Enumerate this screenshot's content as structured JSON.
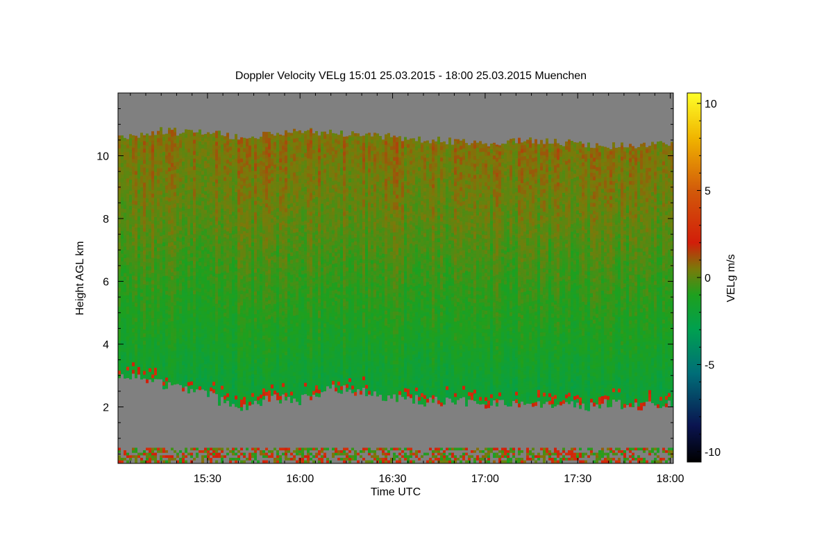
{
  "chart_data": {
    "type": "heatmap",
    "title": "Doppler Velocity VELg   15:01 25.03.2015 - 18:00 25.03.2015 Muenchen",
    "xlabel": "Time UTC",
    "ylabel": "Height AGL km",
    "colorbar_label": "VELg m/s",
    "x_range_minutes_utc": [
      901,
      1081
    ],
    "y_range_km": [
      0.2,
      12.0
    ],
    "x_ticks": [
      {
        "label": "15:30",
        "minute": 930
      },
      {
        "label": "16:00",
        "minute": 960
      },
      {
        "label": "16:30",
        "minute": 990
      },
      {
        "label": "17:00",
        "minute": 1020
      },
      {
        "label": "17:30",
        "minute": 1050
      },
      {
        "label": "18:00",
        "minute": 1080
      }
    ],
    "y_ticks": [
      2,
      4,
      6,
      8,
      10
    ],
    "colorbar_range": [
      -10.6,
      10.6
    ],
    "colorbar_ticks": [
      10,
      5,
      0,
      -5,
      -10
    ],
    "colorbar_stops": [
      {
        "v": -10.6,
        "color": "#000000"
      },
      {
        "v": -8.5,
        "color": "#0a1450"
      },
      {
        "v": -5.5,
        "color": "#006e78"
      },
      {
        "v": -3.0,
        "color": "#00a050"
      },
      {
        "v": -1.0,
        "color": "#1ea01e"
      },
      {
        "v": 0.5,
        "color": "#7a7a0a"
      },
      {
        "v": 2.0,
        "color": "#d21e0a"
      },
      {
        "v": 5.0,
        "color": "#d25a0a"
      },
      {
        "v": 8.0,
        "color": "#f0b400"
      },
      {
        "v": 10.6,
        "color": "#ffff28"
      }
    ],
    "no_data_color": "#808080",
    "cloud_top_km": [
      {
        "t": 901,
        "h": 10.6
      },
      {
        "t": 915,
        "h": 10.8
      },
      {
        "t": 930,
        "h": 10.7
      },
      {
        "t": 945,
        "h": 10.6
      },
      {
        "t": 960,
        "h": 10.8
      },
      {
        "t": 975,
        "h": 10.7
      },
      {
        "t": 990,
        "h": 10.6
      },
      {
        "t": 1005,
        "h": 10.5
      },
      {
        "t": 1020,
        "h": 10.4
      },
      {
        "t": 1035,
        "h": 10.5
      },
      {
        "t": 1050,
        "h": 10.4
      },
      {
        "t": 1065,
        "h": 10.3
      },
      {
        "t": 1081,
        "h": 10.4
      }
    ],
    "cloud_base_km": [
      {
        "t": 901,
        "h": 3.0
      },
      {
        "t": 910,
        "h": 2.9
      },
      {
        "t": 920,
        "h": 2.6
      },
      {
        "t": 930,
        "h": 2.4
      },
      {
        "t": 940,
        "h": 1.9
      },
      {
        "t": 950,
        "h": 2.3
      },
      {
        "t": 960,
        "h": 2.2
      },
      {
        "t": 970,
        "h": 2.6
      },
      {
        "t": 980,
        "h": 2.5
      },
      {
        "t": 990,
        "h": 2.3
      },
      {
        "t": 1000,
        "h": 2.2
      },
      {
        "t": 1010,
        "h": 2.2
      },
      {
        "t": 1020,
        "h": 2.1
      },
      {
        "t": 1030,
        "h": 2.1
      },
      {
        "t": 1040,
        "h": 2.1
      },
      {
        "t": 1050,
        "h": 2.0
      },
      {
        "t": 1060,
        "h": 2.1
      },
      {
        "t": 1070,
        "h": 2.0
      },
      {
        "t": 1081,
        "h": 2.1
      }
    ],
    "velocity_by_height": [
      {
        "h_km": 10.0,
        "vel": 0.6
      },
      {
        "h_km": 8.0,
        "vel": 0.1
      },
      {
        "h_km": 6.0,
        "vel": -0.6
      },
      {
        "h_km": 4.0,
        "vel": -1.3
      },
      {
        "h_km": 2.5,
        "vel": -2.0
      }
    ]
  }
}
